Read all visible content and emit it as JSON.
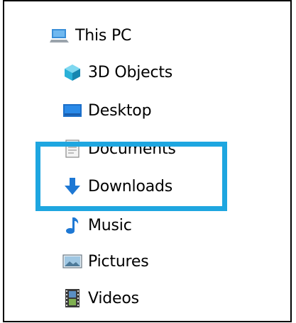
{
  "nav_tree": {
    "root": {
      "label": "This PC",
      "icon": "this-pc-icon"
    },
    "items": [
      {
        "label": "3D Objects",
        "icon": "3d-objects-icon"
      },
      {
        "label": "Desktop",
        "icon": "desktop-icon"
      },
      {
        "label": "Documents",
        "icon": "documents-icon"
      },
      {
        "label": "Downloads",
        "icon": "downloads-icon"
      },
      {
        "label": "Music",
        "icon": "music-icon"
      },
      {
        "label": "Pictures",
        "icon": "pictures-icon"
      },
      {
        "label": "Videos",
        "icon": "videos-icon"
      }
    ]
  },
  "colors": {
    "highlight": "#1ea6e0",
    "download_arrow": "#1e78d4",
    "cube": "#2ab1d8"
  }
}
